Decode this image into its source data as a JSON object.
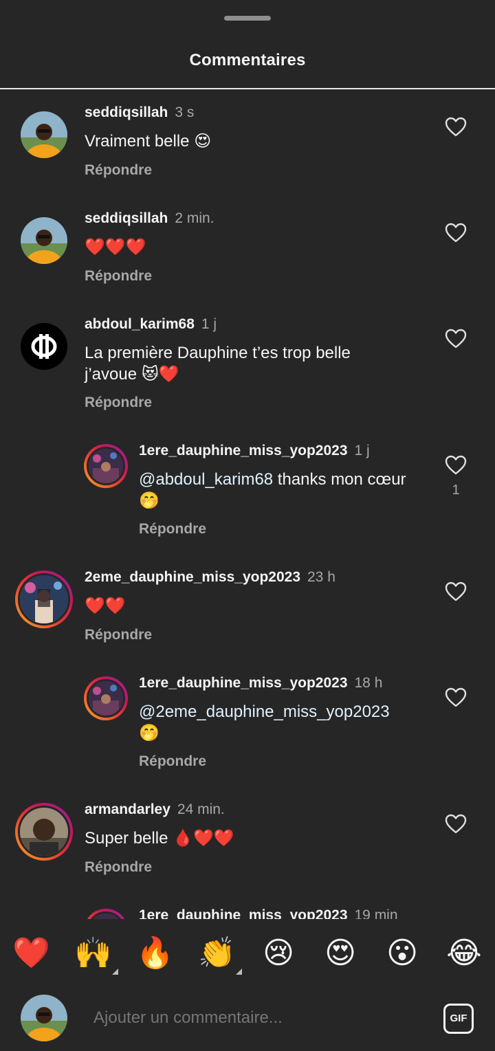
{
  "header": {
    "title": "Commentaires"
  },
  "comments": [
    {
      "username": "seddiqsillah",
      "time": "3 s",
      "text": "Vraiment belle 😍",
      "reply": "Répondre"
    },
    {
      "username": "seddiqsillah",
      "time": "2 min.",
      "text": "❤️❤️❤️",
      "reply": "Répondre"
    },
    {
      "username": "abdoul_karim68",
      "time": "1 j",
      "text_line1": "La première Dauphine t’es trop belle",
      "text_line2": "j’avoue 😻❤️",
      "reply": "Répondre"
    },
    {
      "username": "1ere_dauphine_miss_yop2023",
      "time": "1 j",
      "mention": "@abdoul_karim68",
      "text_rest": " thanks mon cœur",
      "text_line2": "🤭",
      "reply": "Répondre",
      "likes": "1"
    },
    {
      "username": "2eme_dauphine_miss_yop2023",
      "time": "23 h",
      "text": "❤️❤️",
      "reply": "Répondre"
    },
    {
      "username": "1ere_dauphine_miss_yop2023",
      "time": "18 h",
      "mention": "@2eme_dauphine_miss_yop2023",
      "text_line2": "🤭",
      "reply": "Répondre"
    },
    {
      "username": "armandarley",
      "time": "24 min.",
      "text": "Super belle 🩸❤️❤️",
      "reply": "Répondre"
    },
    {
      "username": "1ere_dauphine_miss_yop2023",
      "time": "19 min"
    }
  ],
  "emoji_bar": [
    "❤️",
    "🙌",
    "🔥",
    "👏",
    "😢",
    "😍",
    "😮",
    "😂"
  ],
  "compose": {
    "placeholder": "Ajouter un commentaire...",
    "gif_label": "GIF"
  },
  "icons": {
    "like": "heart-outline-icon",
    "gif": "gif-icon"
  },
  "colors": {
    "background": "#262626",
    "secondary_text": "#a8a8a8",
    "mention": "#e0f1ff"
  }
}
